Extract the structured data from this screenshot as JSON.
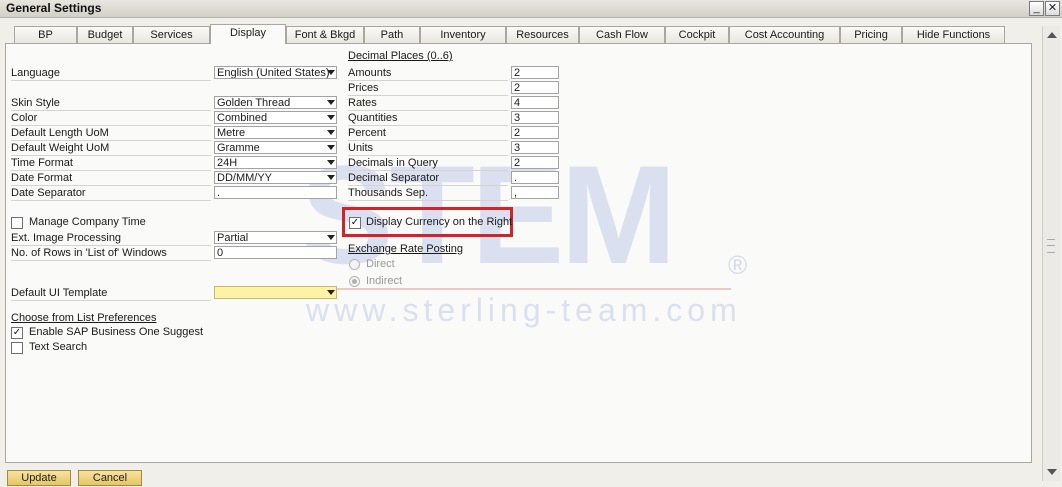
{
  "window": {
    "title": "General Settings",
    "minimize_glyph": "_",
    "close_glyph": "✕"
  },
  "tabs": [
    {
      "label": "BP"
    },
    {
      "label": "Budget"
    },
    {
      "label": "Services"
    },
    {
      "label": "Display",
      "active": true
    },
    {
      "label": "Font & Bkgd"
    },
    {
      "label": "Path"
    },
    {
      "label": "Inventory"
    },
    {
      "label": "Resources"
    },
    {
      "label": "Cash Flow"
    },
    {
      "label": "Cockpit"
    },
    {
      "label": "Cost Accounting"
    },
    {
      "label": "Pricing"
    },
    {
      "label": "Hide Functions"
    }
  ],
  "left": {
    "language": {
      "label": "Language",
      "value": "English (United States)"
    },
    "skin_style": {
      "label": "Skin Style",
      "value": "Golden Thread"
    },
    "color": {
      "label": "Color",
      "value": "Combined"
    },
    "length_uom": {
      "label": "Default Length UoM",
      "value": "Metre"
    },
    "weight_uom": {
      "label": "Default Weight UoM",
      "value": "Gramme"
    },
    "time_format": {
      "label": "Time Format",
      "value": "24H"
    },
    "date_format": {
      "label": "Date Format",
      "value": "DD/MM/YY"
    },
    "date_separator": {
      "label": "Date Separator",
      "value": "."
    },
    "manage_company_time": {
      "label": "Manage Company Time",
      "checked": false
    },
    "ext_image_processing": {
      "label": "Ext. Image Processing",
      "value": "Partial"
    },
    "rows_in_list": {
      "label": "No. of Rows in 'List of' Windows",
      "value": "0"
    },
    "default_ui_template": {
      "label": "Default UI Template",
      "value": ""
    },
    "cfl_header": "Choose from List Preferences",
    "enable_suggest": {
      "label": "Enable SAP Business One Suggest",
      "checked": true,
      "glyph": "✓"
    },
    "text_search": {
      "label": "Text Search",
      "checked": false
    }
  },
  "right": {
    "decimal_header": "Decimal Places  (0..6)",
    "amounts": {
      "label": "Amounts",
      "value": "2"
    },
    "prices": {
      "label": "Prices",
      "value": "2"
    },
    "rates": {
      "label": "Rates",
      "value": "4"
    },
    "quantities": {
      "label": "Quantities",
      "value": "3"
    },
    "percent": {
      "label": "Percent",
      "value": "2"
    },
    "units": {
      "label": "Units",
      "value": "3"
    },
    "decimals_in_query": {
      "label": "Decimals in Query",
      "value": "2"
    },
    "decimal_separator": {
      "label": "Decimal Separator",
      "value": "."
    },
    "thousands_sep": {
      "label": "Thousands Sep.",
      "value": ","
    },
    "display_currency_right": {
      "label": "Display Currency on the Right",
      "checked": true,
      "glyph": "✓"
    },
    "exchange_header": "Exchange Rate Posting",
    "direct": {
      "label": "Direct"
    },
    "indirect": {
      "label": "Indirect"
    }
  },
  "watermark": {
    "logo": "STEM",
    "registered": "®",
    "url": "www.sterling-team.com"
  },
  "buttons": {
    "update": "Update",
    "cancel": "Cancel"
  },
  "colors": {
    "highlight": "#d2232a",
    "button": "#e6c564",
    "yellow_field": "#fdf3a6"
  }
}
